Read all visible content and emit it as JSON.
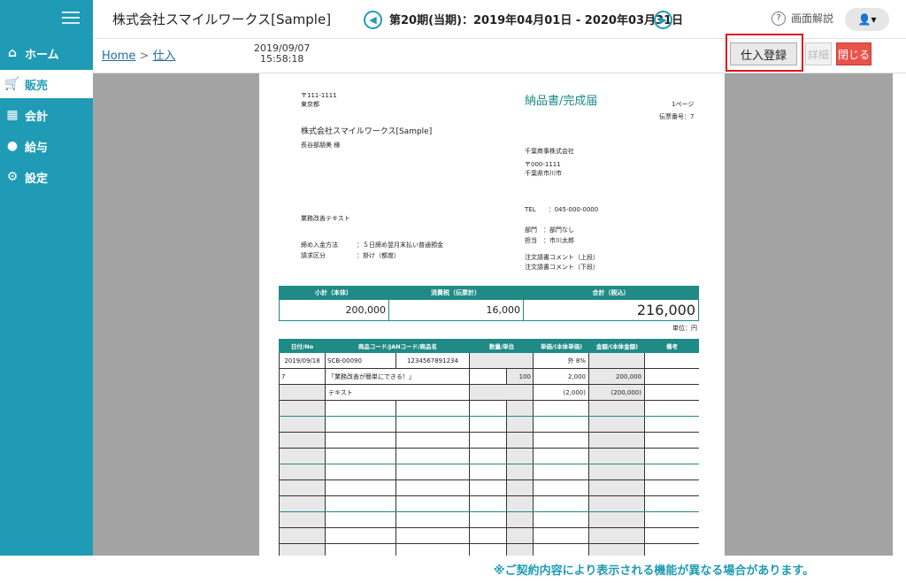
{
  "app": {
    "company": "株式会社スマイルワークス[Sample]",
    "period": "第20期(当期)：2019年04月01日 - 2020年03月31日",
    "help_label": "画面解説"
  },
  "sidebar": {
    "items": [
      {
        "label": "ホーム",
        "icon": "home-icon"
      },
      {
        "label": "販売",
        "icon": "cart-icon"
      },
      {
        "label": "会計",
        "icon": "calculator-icon"
      },
      {
        "label": "給与",
        "icon": "money-bag-icon"
      },
      {
        "label": "設定",
        "icon": "gear-icon"
      }
    ],
    "active": "販売"
  },
  "breadcrumb": {
    "home": "Home",
    "separator": ">",
    "current": "仕入"
  },
  "timestamp": {
    "date": "2019/09/07",
    "time": "15:58:18"
  },
  "actions": {
    "register": "仕入登録",
    "detail": "詳細",
    "close": "閉じる"
  },
  "document": {
    "postal": "〒111-1111",
    "pref": "東京都",
    "title": "納品書/完成届",
    "page": "1ページ",
    "slip_no": "伝票番号：7",
    "recipient_company": "株式会社スマイルワークス[Sample]",
    "recipient_person": "長谷部朋美 様",
    "sender_company": "千葉商事株式会社",
    "sender_postal": "〒000-1111",
    "sender_city": "千葉県市川市",
    "tel": "TEL　　：045-000-0000",
    "memo": "業務改善テキスト",
    "closing_label": "締め入金方法",
    "closing_value": "：５日締め翌月末払い普通預金",
    "billing_label": "請求区分",
    "billing_value": "：掛け（都度）",
    "dept": "部門　：部門なし",
    "staff": "担当　：市川太郎",
    "comment_top": "注文請書コメント（上段）",
    "comment_bottom": "注文請書コメント（下段）",
    "summary": {
      "headers": [
        "小計（本体）",
        "消費税（伝票計）",
        "合計（税込）"
      ],
      "values": [
        "200,000",
        "16,000",
        "216,000"
      ]
    },
    "unit_note": "単位：円",
    "detail_headers": [
      "日付/No",
      "商品コード/JANコード/商品名",
      "数量/単位",
      "単価/(本体単価)",
      "金額/(本体金額)",
      "備考"
    ],
    "rows": [
      [
        "2019/09/18",
        "SCB-00090",
        "1234567891234",
        "",
        "外 8%",
        ""
      ],
      [
        "7",
        "「業務改善が簡単にできる！」",
        "",
        "100",
        "2,000",
        "200,000"
      ],
      [
        "",
        "テキスト",
        "",
        "",
        "(2,000)",
        "(200,000)"
      ]
    ]
  },
  "footnote": "※ご契約内容により表示される機能が異なる場合があります。"
}
